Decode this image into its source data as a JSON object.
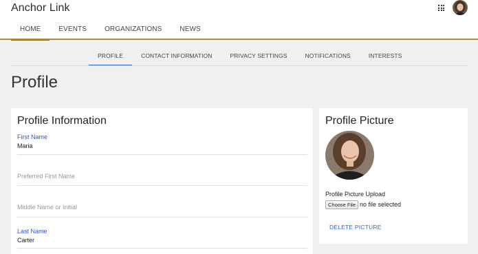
{
  "app": {
    "title": "Anchor Link"
  },
  "main_nav": [
    {
      "label": "HOME",
      "active": true
    },
    {
      "label": "EVENTS",
      "active": false
    },
    {
      "label": "ORGANIZATIONS",
      "active": false
    },
    {
      "label": "NEWS",
      "active": false
    }
  ],
  "sub_nav": [
    {
      "label": "PROFILE",
      "active": true
    },
    {
      "label": "CONTACT INFORMATION",
      "active": false
    },
    {
      "label": "PRIVACY SETTINGS",
      "active": false
    },
    {
      "label": "NOTIFICATIONS",
      "active": false
    },
    {
      "label": "INTERESTS",
      "active": false
    }
  ],
  "page": {
    "title": "Profile"
  },
  "profile_info": {
    "title": "Profile Information",
    "first_name": {
      "label": "First Name",
      "value": "Maria"
    },
    "preferred_first_name": {
      "placeholder": "Preferred First Name"
    },
    "middle_name": {
      "placeholder": "Middle Name or Initial"
    },
    "last_name": {
      "label": "Last Name",
      "value": "Carter"
    }
  },
  "profile_picture": {
    "title": "Profile Picture",
    "upload_label": "Profile Picture Upload",
    "choose_file_label": "Choose File",
    "no_file_text": "no file selected",
    "delete_label": "DELETE PICTURE"
  },
  "colors": {
    "accent_gold": "#b08a3a",
    "accent_blue": "#2a65c9",
    "label_blue": "#3552c6"
  },
  "icons": {
    "apps": "grid-apps-icon",
    "user": "user-avatar"
  }
}
